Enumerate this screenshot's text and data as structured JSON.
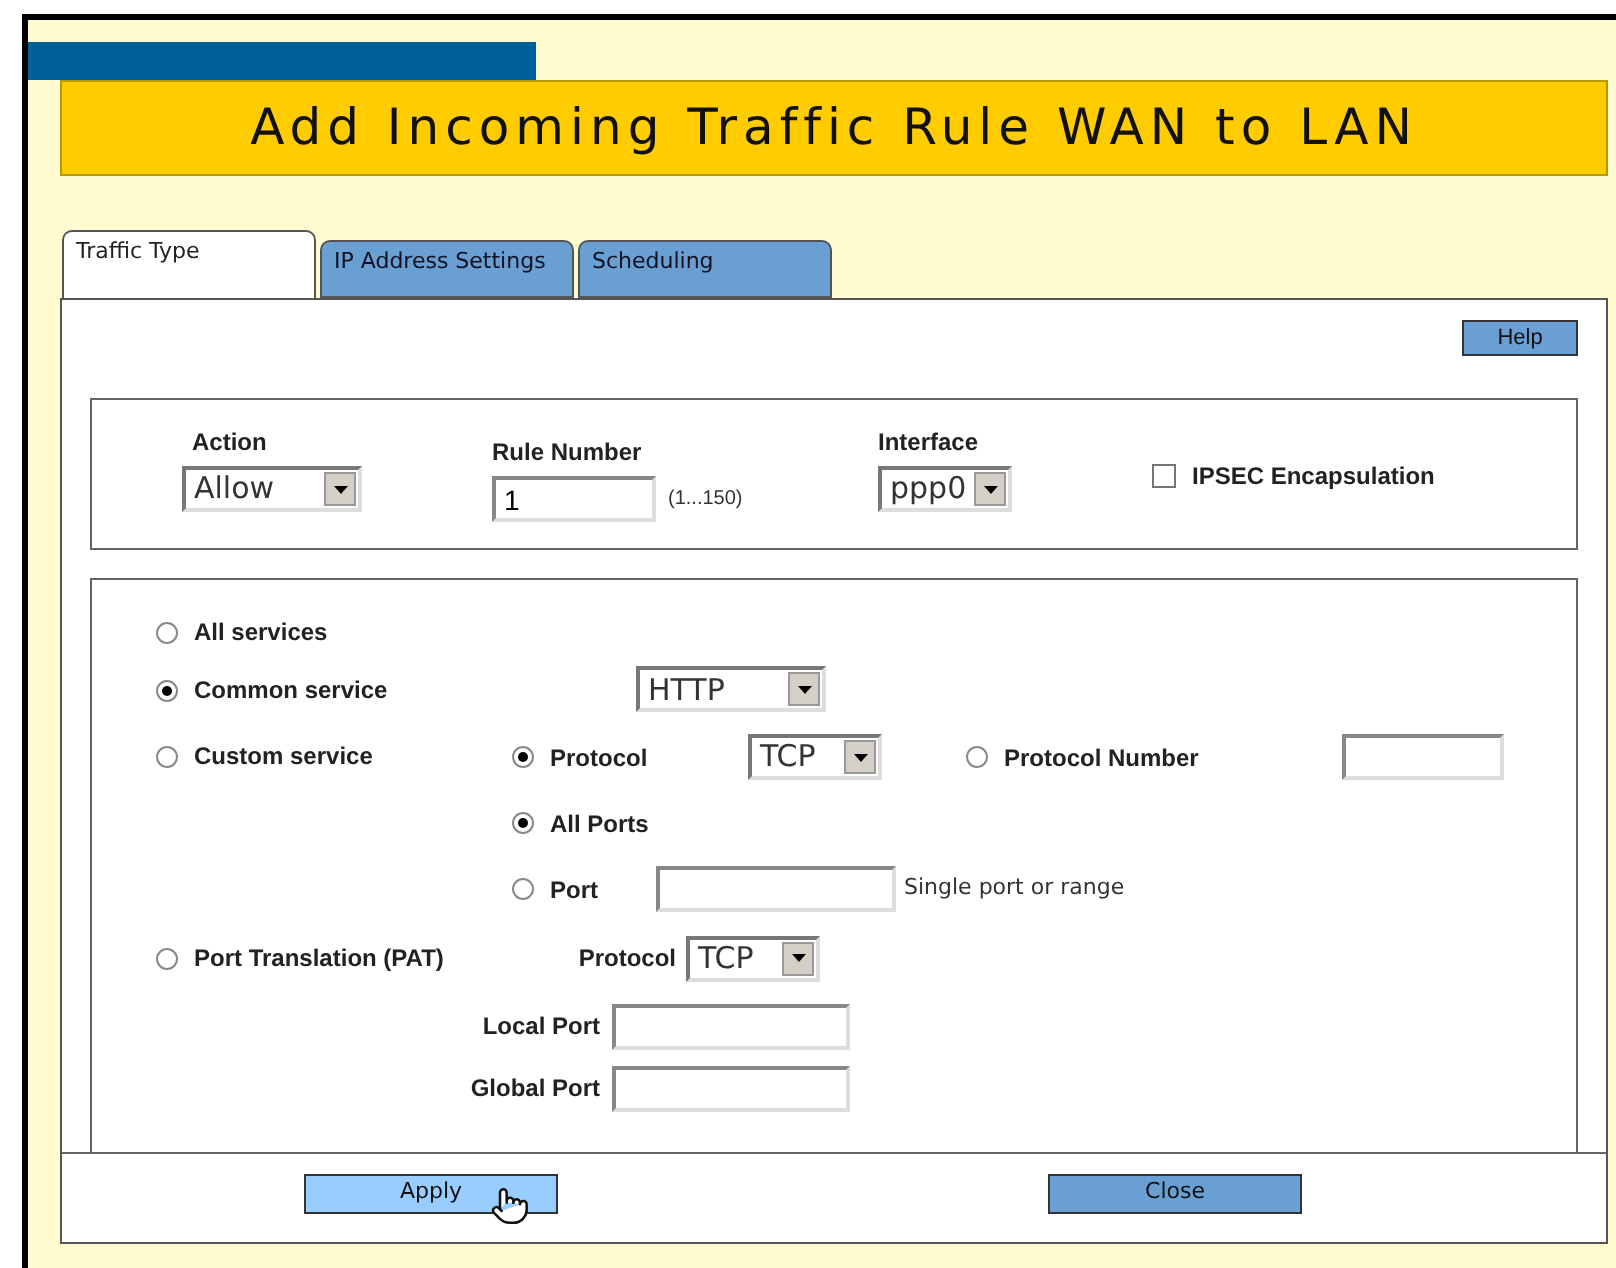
{
  "title": "Add Incoming Traffic Rule WAN to LAN",
  "tabs": [
    {
      "label": "Traffic Type",
      "selected": true
    },
    {
      "label": "IP Address Settings",
      "selected": false
    },
    {
      "label": "Scheduling",
      "selected": false
    }
  ],
  "help_button": "Help",
  "rule": {
    "action": {
      "label": "Action",
      "value": "Allow"
    },
    "rule_number": {
      "label": "Rule Number",
      "value": "1",
      "hint": "(1...150)"
    },
    "interface": {
      "label": "Interface",
      "value": "ppp0"
    },
    "ipsec": {
      "label": "IPSEC Encapsulation",
      "checked": false
    }
  },
  "services": [
    {
      "kind": "all",
      "label": "All services",
      "selected": false
    },
    {
      "kind": "common",
      "label": "Common service",
      "selected": true,
      "value": "HTTP"
    },
    {
      "kind": "custom",
      "label": "Custom service",
      "selected": false,
      "protocol": {
        "label": "Protocol",
        "selected": true,
        "value": "TCP"
      },
      "protocol_number": {
        "label": "Protocol Number",
        "selected": false
      },
      "all_ports": {
        "label": "All Ports",
        "selected": true
      },
      "port": {
        "label": "Port",
        "selected": false,
        "hint": "Single port or range"
      }
    },
    {
      "kind": "pat",
      "label": "Port Translation (PAT)",
      "selected": false,
      "protocol_label": "Protocol",
      "protocol_value": "TCP",
      "local_port_label": "Local Port",
      "global_port_label": "Global Port"
    }
  ],
  "buttons": [
    {
      "label": "Apply",
      "kind": "hover"
    },
    {
      "label": "Close",
      "kind": "normal"
    }
  ]
}
